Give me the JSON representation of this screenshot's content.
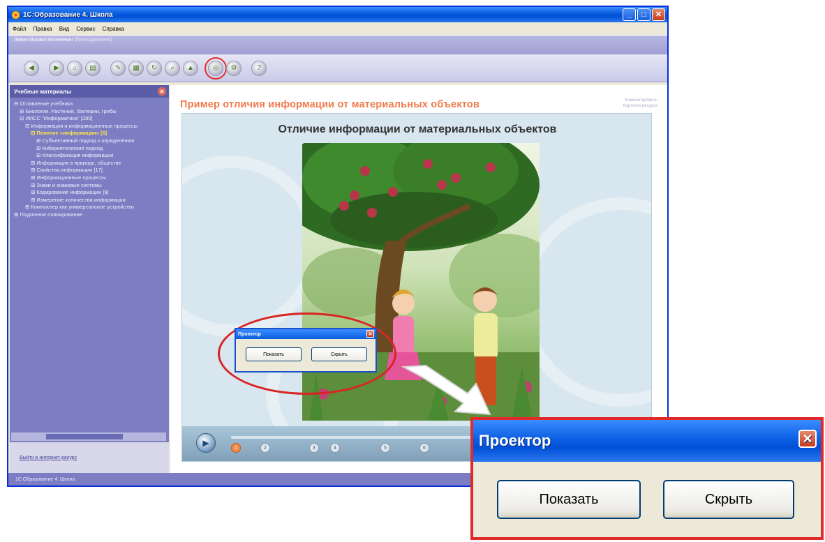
{
  "window": {
    "title": "1С:Образование 4. Школа",
    "controls": {
      "minimize": "_",
      "maximize": "□",
      "close": "✕"
    }
  },
  "menu": [
    "Файл",
    "Правка",
    "Вид",
    "Сервис",
    "Справка"
  ],
  "userbar": {
    "user": "Левин Михаил Матвеевич",
    "role": "[Преподаватель]"
  },
  "toolbar": {
    "icons": [
      "back-icon",
      "forward-icon",
      "home-icon",
      "print-icon",
      "notes-icon",
      "library-icon",
      "refresh-icon",
      "search-icon",
      "tree-icon",
      "projector-icon",
      "settings-icon",
      "help-icon"
    ],
    "highlighted": "projector-icon",
    "highlight_color": "#e03030"
  },
  "sidebar": {
    "title": "Учебные материалы",
    "tree": [
      {
        "text": "⊟ Оглавление учебника",
        "level": 0
      },
      {
        "text": "⊞ Биология. Растения, бактерии, грибы",
        "level": 1
      },
      {
        "text": "⊟ ИИСС \"Информатика\" [280]",
        "level": 1
      },
      {
        "text": "⊟ Информация и информационные процессы",
        "level": 2
      },
      {
        "text": "⊟ Понятие «информация» [6]",
        "level": 3,
        "selected": true
      },
      {
        "text": "⊞ Субъективный подход к определению",
        "level": 4
      },
      {
        "text": "⊞ Кибернетический подход",
        "level": 4
      },
      {
        "text": "⊞ Классификация информации",
        "level": 4
      },
      {
        "text": "⊞ Информация в природе, обществе",
        "level": 3
      },
      {
        "text": "⊞ Свойства информации [17]",
        "level": 3
      },
      {
        "text": "⊞ Информационные процессы",
        "level": 3
      },
      {
        "text": "⊞ Знаки и знаковые системы",
        "level": 3
      },
      {
        "text": "⊞ Кодирование информации [9]",
        "level": 3
      },
      {
        "text": "⊞ Измерение количества информации",
        "level": 3
      },
      {
        "text": "⊞ Компьютер как универсальное устройство",
        "level": 2
      },
      {
        "text": "⊞ Поурочное планирование",
        "level": 0
      }
    ],
    "footer_link": "Выйти в интернет-ресурс"
  },
  "statusbar": {
    "text": "1С:Образование 4. Школа"
  },
  "content": {
    "lesson_title": "Пример отличия информации от материальных объектов",
    "side_links": [
      "Комментировать",
      "Карточка ресурса"
    ],
    "slide_title": "Отличие информации от материальных объектов",
    "timeline_marks": [
      "1",
      "2",
      "3",
      "4",
      "5",
      "6"
    ]
  },
  "projector_dialog_small": {
    "title": "Проектор",
    "show_button": "Показать",
    "hide_button": "Скрыть"
  },
  "projector_dialog_zoomed": {
    "title": "Проектор",
    "show_button": "Показать",
    "hide_button": "Скрыть",
    "highlight_color": "#e12b2b"
  }
}
